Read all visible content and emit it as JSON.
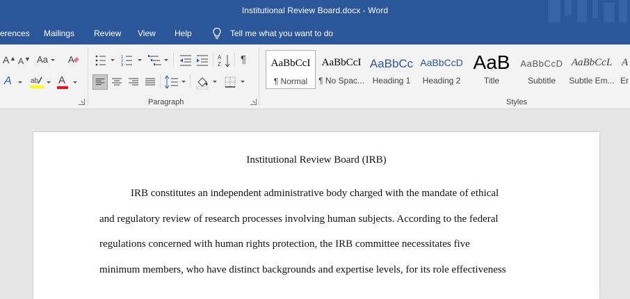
{
  "window": {
    "title": "Institutional Review Board.docx  -  Word"
  },
  "tabs": [
    {
      "id": "references",
      "label": "erences"
    },
    {
      "id": "mailings",
      "label": "Mailings"
    },
    {
      "id": "review",
      "label": "Review"
    },
    {
      "id": "view",
      "label": "View"
    },
    {
      "id": "help",
      "label": "Help"
    }
  ],
  "tell_me": {
    "label": "Tell me what you want to do"
  },
  "ribbon": {
    "font_group": {
      "grow_font": "A",
      "shrink_font": "A",
      "change_case": "Aa",
      "text_effects": "A",
      "font_color": "A"
    },
    "paragraph_group": {
      "label": "Paragraph",
      "pilcrow": "¶"
    },
    "styles_group": {
      "label": "Styles",
      "styles": [
        {
          "sample": "AaBbCcI",
          "name": "¶ Normal",
          "color": "#000000"
        },
        {
          "sample": "AaBbCcI",
          "name": "¶ No Spac...",
          "color": "#000000"
        },
        {
          "sample": "AaBbCc",
          "name": "Heading 1",
          "color": "#2f5597"
        },
        {
          "sample": "AaBbCcD",
          "name": "Heading 2",
          "color": "#2f5597"
        },
        {
          "sample": "AaB",
          "name": "Title",
          "color": "#000000"
        },
        {
          "sample": "AaBbCcD",
          "name": "Subtitle",
          "color": "#595959"
        },
        {
          "sample": "AaBbCcL",
          "name": "Subtle Em...",
          "color": "#404040"
        },
        {
          "sample": "A",
          "name": "Er",
          "color": "#404040"
        }
      ]
    }
  },
  "document": {
    "title": "Institutional Review Board (IRB)",
    "lines": [
      "IRB constitutes an independent administrative body charged with the mandate of ethical",
      "and regulatory review of research processes involving human subjects. According to the federal",
      "regulations concerned with human rights protection, the IRB committee necessitates five",
      "minimum members, who have distinct backgrounds and expertise levels, for its role effectiveness"
    ]
  },
  "colors": {
    "title_bar": "#2b579a",
    "ribbon_bg": "#f3f3f3",
    "doc_bg": "#e6e6e6",
    "highlight": "#ffff00",
    "font_color_red": "#e81123"
  }
}
